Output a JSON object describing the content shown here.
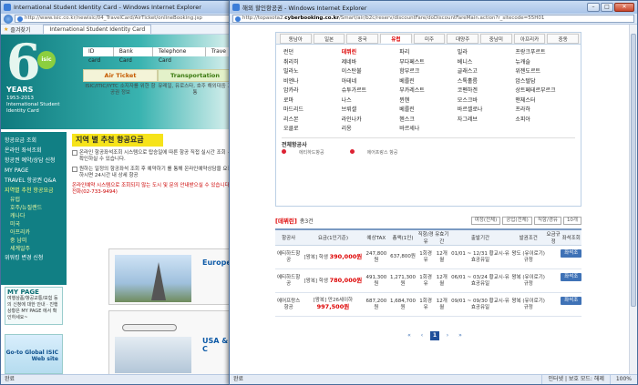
{
  "bg_window": {
    "title": "International Student Identity Card - Windows Internet Explorer",
    "url": "http://www.isic.co.kr/newisic/04_TravelCard/AirTicket/onlineBooking.jsp",
    "favorites": "즐겨찾기",
    "tab": "International Student Identity Card",
    "logo": {
      "six": "6",
      "badge": "isic",
      "years": "YEARS",
      "range": "1953-2013",
      "sub1": "International Student",
      "sub2": "Identity Card"
    },
    "menu": [
      "ID card",
      "Bank Card",
      "Telephone Card",
      "Trave"
    ],
    "tabs": [
      {
        "label": "Air Ticket",
        "desc": "ISIC/ITIC/IYTC 소지자를 위한 항공권 정보"
      },
      {
        "label": "Transportation",
        "desc": "유레일, 유로스타, 호주 해외대중 교통"
      }
    ],
    "leftnav": [
      {
        "t": "항공요금 조회"
      },
      {
        "t": "온라인 좌석조회"
      },
      {
        "t": "항공권 예약/상담 신청"
      },
      {
        "t": "MY PAGE"
      },
      {
        "t": "TRAVEL 항공권 Q&A"
      },
      {
        "t": "지역별 추천 항공요금",
        "hl": true
      },
      {
        "t": "유럽",
        "sub": true
      },
      {
        "t": "호주/뉴질랜드",
        "sub": true
      },
      {
        "t": "캐나다",
        "sub": true
      },
      {
        "t": "미국",
        "sub": true
      },
      {
        "t": "아프리카",
        "sub": true
      },
      {
        "t": "중 남미",
        "sub": true
      },
      {
        "t": "세계일주",
        "sub": true
      },
      {
        "t": "위워킹 변경 신청"
      }
    ],
    "mypage": {
      "title": "MY PAGE",
      "text": "여행상품/항공교통/보험 등의 신청에 대한 안내 · 진행상황은 MY PAGE 에서 확인하세요~"
    },
    "goto": "Go-to Global ISIC Web site",
    "content_title": "지역 별 추천 항공요금",
    "p1": "온라인 항공좌석조회 시스템으로 탑승일에 따른 항공 직접 실시간 조회 · 확인하실 수 있습니다.",
    "p2": "원하는 일정의 항공좌석 조회 후 예약하기 를 통해 온라인예약상담을 요청하시면 24시간 내 상세 항공",
    "p3": "온라인예약 시스템으로 조회되지 않는 도시 및 문의 안내받으실 수 있습니다. 전화(02-733-9494)",
    "europe": "Europe",
    "usa": "USA & C",
    "status": "완료"
  },
  "fg_window": {
    "title": "해외 할인항공권 - Windows Internet Explorer",
    "url_pre": "http://topasota2.",
    "url_domain": "cyberbooking.co.kr",
    "url_post": "/Smart/air/b2c/reserv/discountFare/doDiscountFareMain.action?r_sitecode=55H01",
    "region_tabs": [
      "동남아",
      "일본",
      "중국",
      "유럽",
      "미주",
      "대양주",
      "중남미",
      "아프리카",
      "중동"
    ],
    "active_tab": "유럽",
    "cities": [
      "런던",
      "데뷔린",
      "파리",
      "밀라",
      "프랑크푸르트",
      "취리히",
      "제네바",
      "부다페스트",
      "베니스",
      "뉴캐슬",
      "밀라노",
      "이스탄불",
      "함부르크",
      "글래스고",
      "위젠도르트",
      "비엔나",
      "아테네",
      "베를린",
      "스톡홀름",
      "암스텔담",
      "암카라",
      "슈투가르트",
      "부카레스트",
      "코펜하겐",
      "상트페테르부르크",
      "로마",
      "나스",
      "뮌헨",
      "모스크바",
      "맨체스터",
      "마드리드",
      "브뤼셀",
      "베를린",
      "바르셀로나",
      "프라하",
      "리스본",
      "라인나카",
      "헨스크",
      "자그레브",
      "소피아",
      "오클로",
      "리옹",
      "바르세나",
      "",
      ""
    ],
    "highlight_city": "데뷔린",
    "airline_header": "전체항공사",
    "airlines": [
      "에티하드항공",
      "에어프랑스 항공"
    ],
    "result_city": "[데뷔린]",
    "result_count": "총3건",
    "filters": [
      "여정(전체)",
      "공입(전체)",
      "직항/경유",
      "10개"
    ],
    "columns": [
      "항공사",
      "요금(1인기준)",
      "예상TAX",
      "총액(1인)",
      "직항/경유",
      "유효기간",
      "출발기간",
      "발권조건",
      "요금규정",
      "좌석조회"
    ],
    "rows": [
      {
        "airline": "에티하드항공",
        "type": "[왕복] 학생",
        "price": "390,000원",
        "tax": "247,800원",
        "total": "637,800원",
        "stops": "1회경유",
        "valid": "12개월",
        "period": "01/01 ~ 12/31 황교시-유효공유일",
        "cond": "왕도 (유이로기) 규정",
        "btn": "좌석조회"
      },
      {
        "airline": "에티하드항공",
        "type": "[왕복] 학생",
        "price": "780,000원",
        "tax": "491,300원",
        "total": "1,271,300원",
        "stops": "1회경유",
        "valid": "12개월",
        "period": "06/01 ~ 03/24 황교시-유효공유일",
        "cond": "왕복 (유이로기) 규정",
        "btn": "좌석조회"
      },
      {
        "airline": "에어프랑스 항공",
        "type": "[왕복] 만26세이하",
        "price": "997,500원",
        "tax": "687,200원",
        "total": "1,684,700원",
        "stops": "1회경유",
        "valid": "12개월",
        "period": "09/01 ~ 09/30 황교시-유효공유일",
        "cond": "왕복 (유이로기) 규정",
        "btn": "좌석조회"
      }
    ],
    "pager": [
      "«",
      "‹",
      "1",
      "›",
      "»"
    ],
    "status_left": "완료",
    "status_mid": "인터넷 | 보호 모드: 해제",
    "zoom": "100%"
  }
}
